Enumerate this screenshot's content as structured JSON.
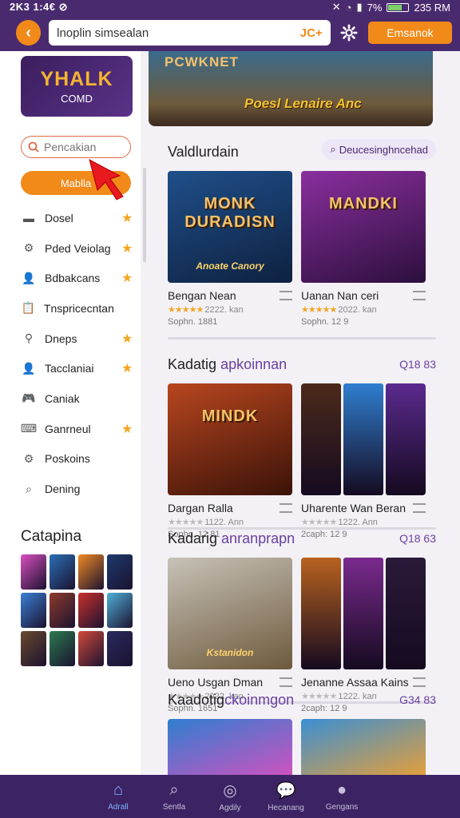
{
  "status_bar": {
    "left": "2K3 1:4€ ⊘",
    "battery": "7%",
    "time": "235 RM",
    "battery_level": 0.7
  },
  "topbar": {
    "back_icon": "chevron-left-icon",
    "url_value": "lnoplin simsealan",
    "url_suffix": "JC+",
    "settings_icon": "gear-icon",
    "button_label": "Emsanok"
  },
  "sidebar": {
    "logo_line1": "YHALK",
    "logo_line2": "COMD",
    "search_placeholder": "Pencakian",
    "button_label": "Mablla",
    "items": [
      {
        "label": "Dosel",
        "icon": "book-icon",
        "starred": true
      },
      {
        "label": "Pded Veiolag",
        "icon": "gear-icon",
        "starred": true
      },
      {
        "label": "Bdbakcans",
        "icon": "person-icon",
        "starred": true
      },
      {
        "label": "Tnspricecntan",
        "icon": "clipboard-icon",
        "starred": false
      },
      {
        "label": "Dneps",
        "icon": "pin-icon",
        "starred": true
      },
      {
        "label": "Tacclaniai",
        "icon": "person-icon",
        "starred": true
      },
      {
        "label": "Caniak",
        "icon": "gamepad-icon",
        "starred": false
      },
      {
        "label": "Ganrneul",
        "icon": "keyboard-icon",
        "starred": true
      },
      {
        "label": "Poskoins",
        "icon": "gear-icon",
        "starred": false
      },
      {
        "label": "Dening",
        "icon": "search-icon",
        "starred": false
      }
    ],
    "categories_title": "Catapina",
    "category_colors": [
      "#d94fbf",
      "#2a6fb5",
      "#f08a24",
      "#1d3a6e",
      "#3a7fd4",
      "#8e3b2c",
      "#c9312b",
      "#4fb0d8",
      "#6a4a2e",
      "#2d7a4f",
      "#d04a3a",
      "#2a2a5e"
    ]
  },
  "banner": {
    "title": "PCWKNET",
    "subtitle": "Poesl Lenaire Anc"
  },
  "sections": [
    {
      "title_plain": "Valdlurdain",
      "title_accent": "",
      "count": "",
      "pill": "Deucesinghncehad",
      "cards": [
        {
          "title": "Bengan Nean",
          "thumb_title": "MONK DURADISN",
          "thumb_caption": "Anoate Canory",
          "rating": "2222. kan",
          "sub": "Sophn. 1881",
          "colors": [
            "#1f4f8a",
            "#0e2140"
          ]
        },
        {
          "title": "Uanan Nan ceri",
          "thumb_title": "MANDKI",
          "thumb_caption": "",
          "rating": "2022. kan",
          "sub": "Sophn. 12 9",
          "colors": [
            "#8a2f9e",
            "#2c0f3d"
          ]
        }
      ]
    },
    {
      "title_plain": "Kadatig ",
      "title_accent": "apkoinnan",
      "count": "Q18 83",
      "cards": [
        {
          "title": "Dargan Ralla",
          "thumb_title": "MINDK",
          "thumb_caption": "",
          "rating": "1122. Ann",
          "sub": "Sophn. 12 81",
          "colors": [
            "#b8461f",
            "#3b1208"
          ]
        },
        {
          "title": "Uharente Wan Beran",
          "thumb_title": "",
          "thumb_caption": "",
          "rating": "1222. Ann",
          "sub": "2caph: 12 9",
          "colors": [
            "#4b2a1a",
            "#2f7fd0",
            "#5a2a8e"
          ]
        }
      ]
    },
    {
      "title_plain": "Kadarig ",
      "title_accent": "anranprapn",
      "count": "Q18 63",
      "cards": [
        {
          "title": "Ueno Usgan Dman",
          "thumb_title": "",
          "thumb_caption": "Kstanidon",
          "rating": "2022. kan",
          "sub": "Sophn. 1651",
          "colors": [
            "#c7c2b8",
            "#6e5a3c"
          ]
        },
        {
          "title": "Jenanne Assaa Kains",
          "thumb_title": "",
          "thumb_caption": "",
          "rating": "1222. kan",
          "sub": "2caph: 12 9",
          "colors": [
            "#b8621f",
            "#7a2a8e",
            "#2a1a3a"
          ]
        }
      ]
    },
    {
      "title_plain": "Kaadotig",
      "title_accent": "ckoinmgon",
      "count": "G34 83",
      "cards": [
        {
          "title": "",
          "thumb_title": "",
          "thumb_caption": "",
          "rating": "",
          "sub": "",
          "colors": [
            "#2f7fd0",
            "#d94fbf"
          ]
        },
        {
          "title": "",
          "thumb_title": "",
          "thumb_caption": "",
          "rating": "",
          "sub": "",
          "colors": [
            "#3a8fd4",
            "#f0a030"
          ]
        }
      ]
    }
  ],
  "bottom_nav": [
    {
      "label": "Adrall",
      "icon": "home-icon",
      "active": true
    },
    {
      "label": "Sentla",
      "icon": "search-icon",
      "active": false
    },
    {
      "label": "Agdily",
      "icon": "compass-icon",
      "active": false
    },
    {
      "label": "Hecanang",
      "icon": "chat-icon",
      "active": false
    },
    {
      "label": "Gengans",
      "icon": "profile-icon",
      "active": false
    }
  ]
}
